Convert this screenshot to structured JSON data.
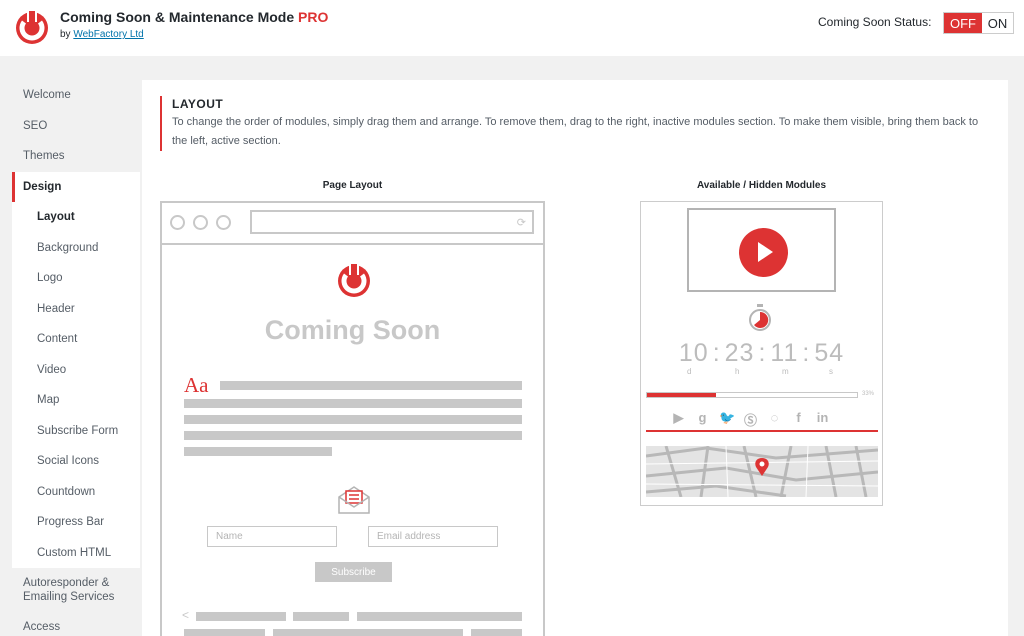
{
  "header": {
    "title": "Coming Soon & Maintenance Mode",
    "title_badge": "PRO",
    "byline_prefix": "by",
    "byline_link": "WebFactory Ltd",
    "status_label": "Coming Soon Status:",
    "toggle_off": "OFF",
    "toggle_on": "ON",
    "status_value": "OFF",
    "logo_icon": "power-icon"
  },
  "sidebar": {
    "top_items": [
      "Welcome",
      "SEO",
      "Themes"
    ],
    "active_item": "Design",
    "sub_items": [
      "Layout",
      "Background",
      "Logo",
      "Header",
      "Content",
      "Video",
      "Map",
      "Subscribe Form",
      "Social Icons",
      "Countdown",
      "Progress Bar",
      "Custom HTML"
    ],
    "current_sub": "Layout",
    "bottom_items": [
      "Autoresponder & Emailing Services",
      "Access"
    ]
  },
  "section": {
    "title": "LAYOUT",
    "description": "To change the order of modules, simply drag them and arrange. To remove them, drag to the right, inactive modules section. To make them visible, bring them back to the left, active section."
  },
  "page_layout": {
    "title": "Page Layout",
    "heading": "Coming Soon",
    "aa": "Aa",
    "name_placeholder": "Name",
    "email_placeholder": "Email address",
    "subscribe_label": "Subscribe",
    "reload_icon": "reload-icon",
    "prev_glyph": "<"
  },
  "available": {
    "title": "Available / Hidden Modules",
    "countdown": {
      "d": "10",
      "h": "23",
      "m": "11",
      "s": "54"
    },
    "countdown_labels": {
      "d": "d",
      "h": "h",
      "m": "m",
      "s": "s"
    },
    "progress_percent": 33,
    "progress_label": "33%",
    "social_icons": [
      "youtube-icon",
      "google-plus-icon",
      "twitter-icon",
      "skype-icon",
      "whatsapp-icon",
      "facebook-icon",
      "linkedin-icon"
    ]
  },
  "colors": {
    "accent": "#dd3333",
    "link": "#0073aa",
    "mock_gray": "#c8c8c8"
  }
}
